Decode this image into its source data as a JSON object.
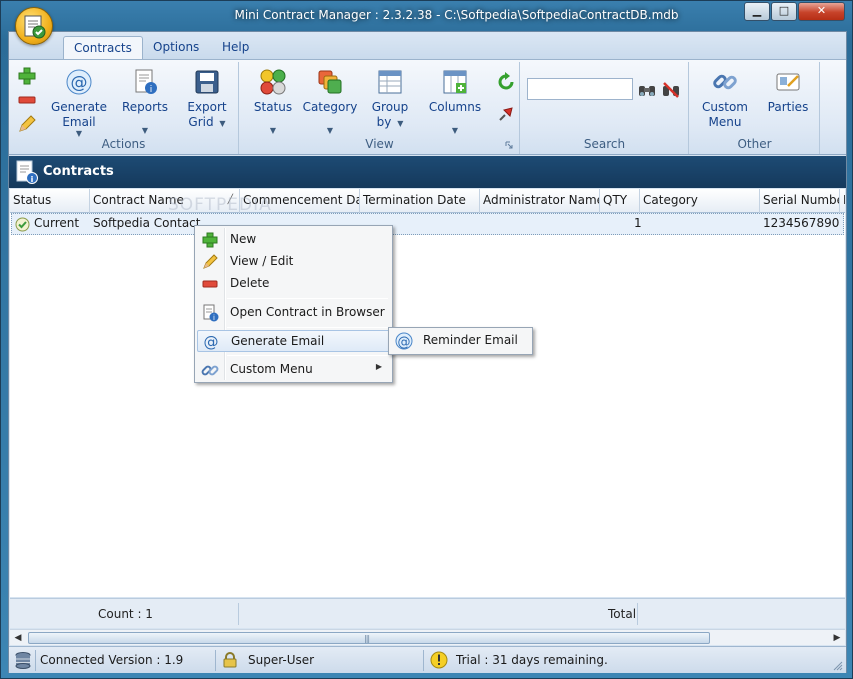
{
  "window": {
    "title": "Mini Contract Manager : 2.3.2.38 - C:\\Softpedia\\SoftpediaContractDB.mdb"
  },
  "ribbon": {
    "tabs": [
      {
        "label": "Contracts",
        "active": true
      },
      {
        "label": "Options",
        "active": false
      },
      {
        "label": "Help",
        "active": false
      }
    ],
    "groups": {
      "actions": {
        "label": "Actions",
        "generate_email": "Generate\nEmail",
        "reports": "Reports",
        "export_grid": "Export\nGrid"
      },
      "view": {
        "label": "View",
        "status": "Status",
        "category": "Category",
        "group_by": "Group\nby",
        "columns": "Columns"
      },
      "search": {
        "label": "Search",
        "placeholder": ""
      },
      "other": {
        "label": "Other",
        "custom_menu": "Custom\nMenu",
        "parties": "Parties"
      }
    }
  },
  "contracts_panel": {
    "title": "Contracts"
  },
  "grid": {
    "columns": [
      "Status",
      "Contract Name",
      "Commencement Date",
      "Termination Date",
      "Administrator Name",
      "QTY",
      "Category",
      "Serial Number",
      "P"
    ],
    "rows": [
      {
        "status": "Current",
        "contract_name": "Softpedia Contact",
        "commencement_date": "",
        "termination_date": "",
        "administrator_name": "",
        "qty": "1",
        "category": "",
        "serial_number": "1234567890"
      }
    ],
    "footer": {
      "count": "Count : 1",
      "total": "Total"
    }
  },
  "context_menu": {
    "items": [
      "New",
      "View / Edit",
      "Delete",
      "Open Contract in Browser",
      "Generate Email",
      "Custom Menu"
    ],
    "submenu": [
      "Reminder Email"
    ]
  },
  "statusbar": {
    "connection": "Connected Version : 1.9",
    "user": "Super-User",
    "trial": "Trial : 31 days remaining."
  },
  "watermark": "SOFTPEDIA",
  "colors": {
    "header_navy": "#1d4b74",
    "ribbon_text": "#15428b",
    "accent_orb": "#f2b01c"
  }
}
